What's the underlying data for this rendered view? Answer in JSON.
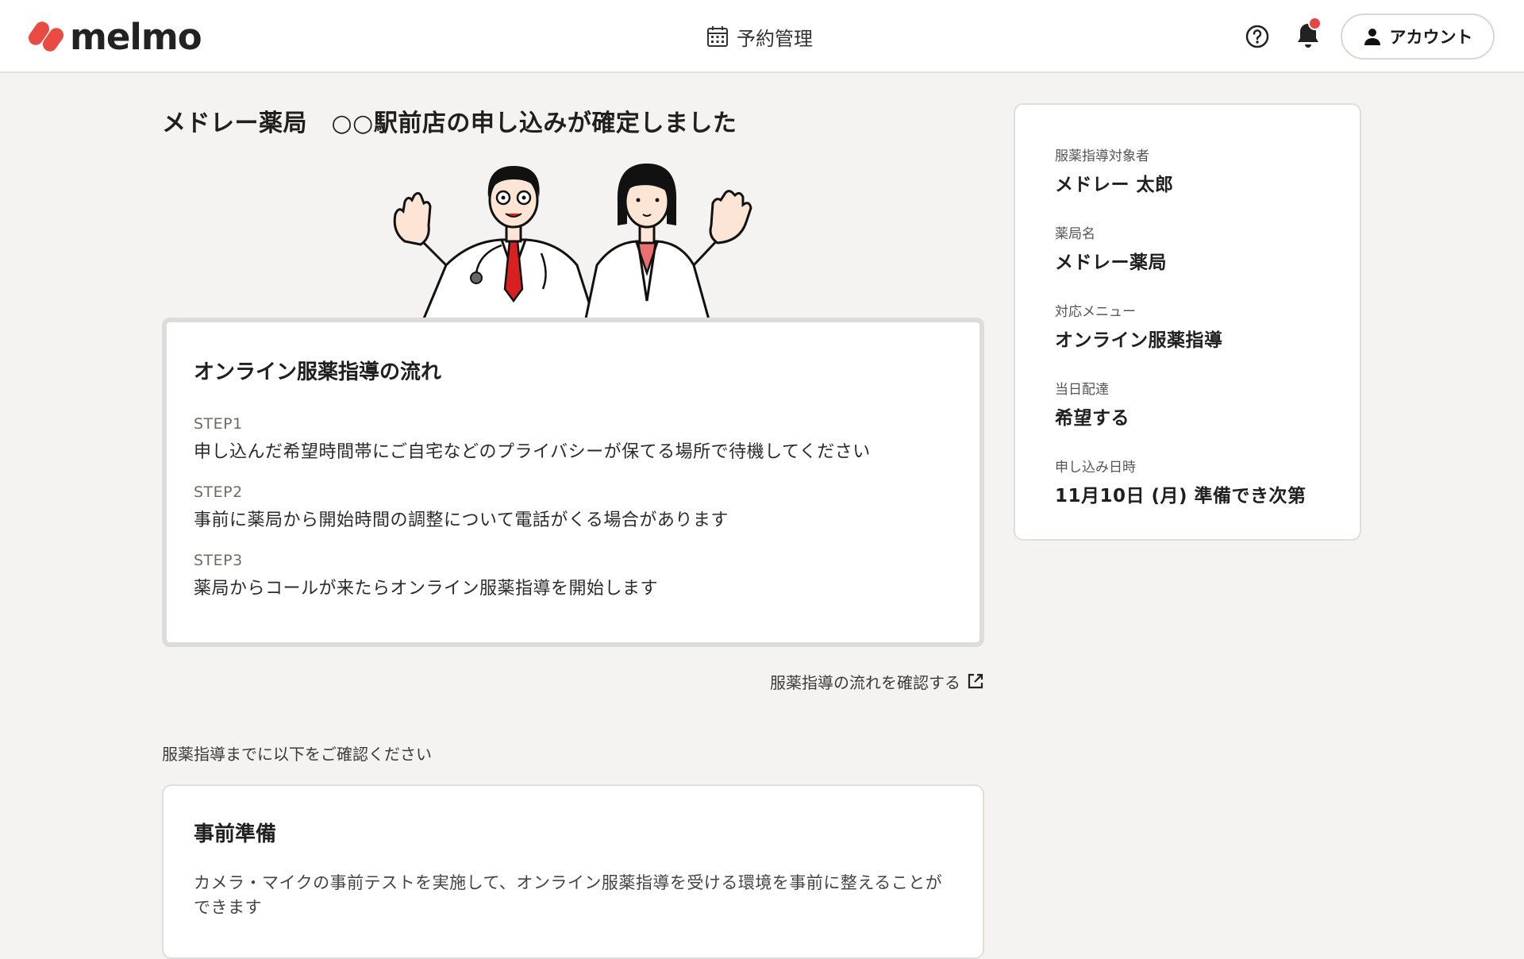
{
  "header": {
    "logo_text": "melmo",
    "nav_label": "予約管理",
    "account_label": "アカウント",
    "brand_color": "#e94b43"
  },
  "main": {
    "title": "メドレー薬局　○○駅前店の申し込みが確定しました",
    "flow": {
      "heading": "オンライン服薬指導の流れ",
      "steps": [
        {
          "label": "STEP1",
          "text": "申し込んだ希望時間帯にご自宅などのプライバシーが保てる場所で待機してください"
        },
        {
          "label": "STEP2",
          "text": "事前に薬局から開始時間の調整について電話がくる場合があります"
        },
        {
          "label": "STEP3",
          "text": "薬局からコールが来たらオンライン服薬指導を開始します"
        }
      ]
    },
    "flow_link": "服薬指導の流れを確認する",
    "confirm_heading": "服薬指導までに以下をご確認ください",
    "prep": {
      "heading": "事前準備",
      "text": "カメラ・マイクの事前テストを実施して、オンライン服薬指導を受ける環境を事前に整えることができます"
    }
  },
  "summary": {
    "items": [
      {
        "label": "服薬指導対象者",
        "value": "メドレー 太郎"
      },
      {
        "label": "薬局名",
        "value": "メドレー薬局"
      },
      {
        "label": "対応メニュー",
        "value": "オンライン服薬指導"
      },
      {
        "label": "当日配達",
        "value": "希望する"
      },
      {
        "label": "申し込み日時",
        "value": "11月10日 (月) 準備でき次第"
      }
    ]
  }
}
